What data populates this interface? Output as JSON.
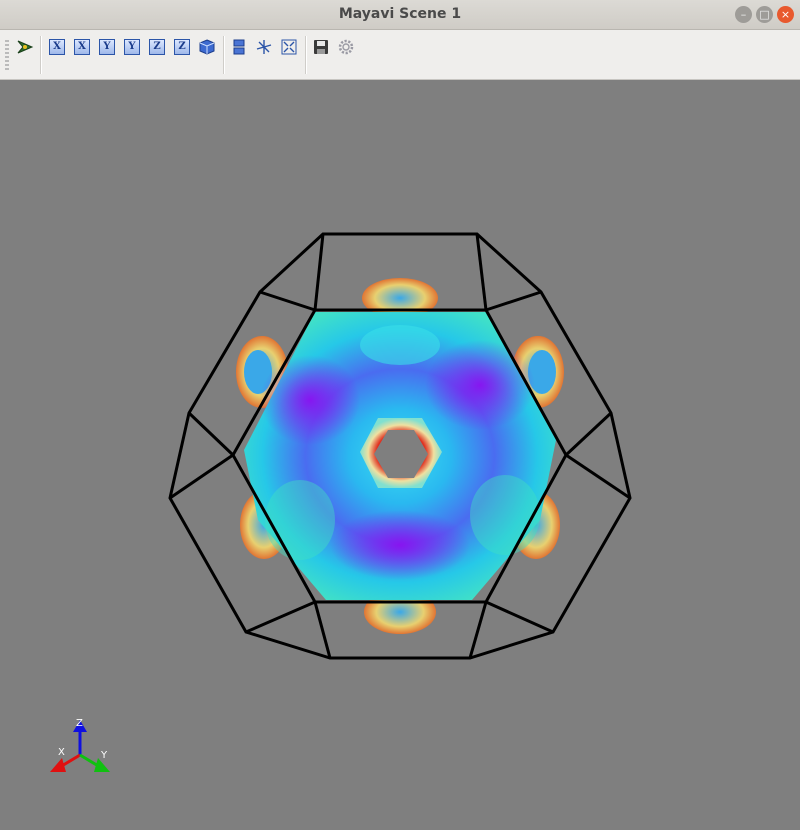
{
  "window": {
    "title": "Mayavi Scene 1"
  },
  "window_buttons": {
    "minimize": "–",
    "maximize": "□",
    "close": "×"
  },
  "toolbar": {
    "buttons": [
      {
        "icon": "mayavi-logo-icon"
      },
      {
        "icon": "view-x-plus-icon",
        "label": "X"
      },
      {
        "icon": "view-x-minus-icon",
        "label": "X"
      },
      {
        "icon": "view-y-plus-icon",
        "label": "Y"
      },
      {
        "icon": "view-y-minus-icon",
        "label": "Y"
      },
      {
        "icon": "view-z-plus-icon",
        "label": "Z"
      },
      {
        "icon": "view-z-minus-icon",
        "label": "Z"
      },
      {
        "icon": "isometric-view-icon"
      },
      {
        "icon": "parallel-projection-icon"
      },
      {
        "icon": "axes-toggle-icon"
      },
      {
        "icon": "full-screen-icon"
      },
      {
        "icon": "save-icon"
      },
      {
        "icon": "settings-icon"
      }
    ]
  },
  "scene": {
    "background": "#7f7f7f",
    "wireframe_color": "#000000",
    "orientation_axes": {
      "x": "X",
      "y": "Y",
      "z": "Z",
      "x_color": "#e01010",
      "y_color": "#10c010",
      "z_color": "#1010e0"
    }
  }
}
